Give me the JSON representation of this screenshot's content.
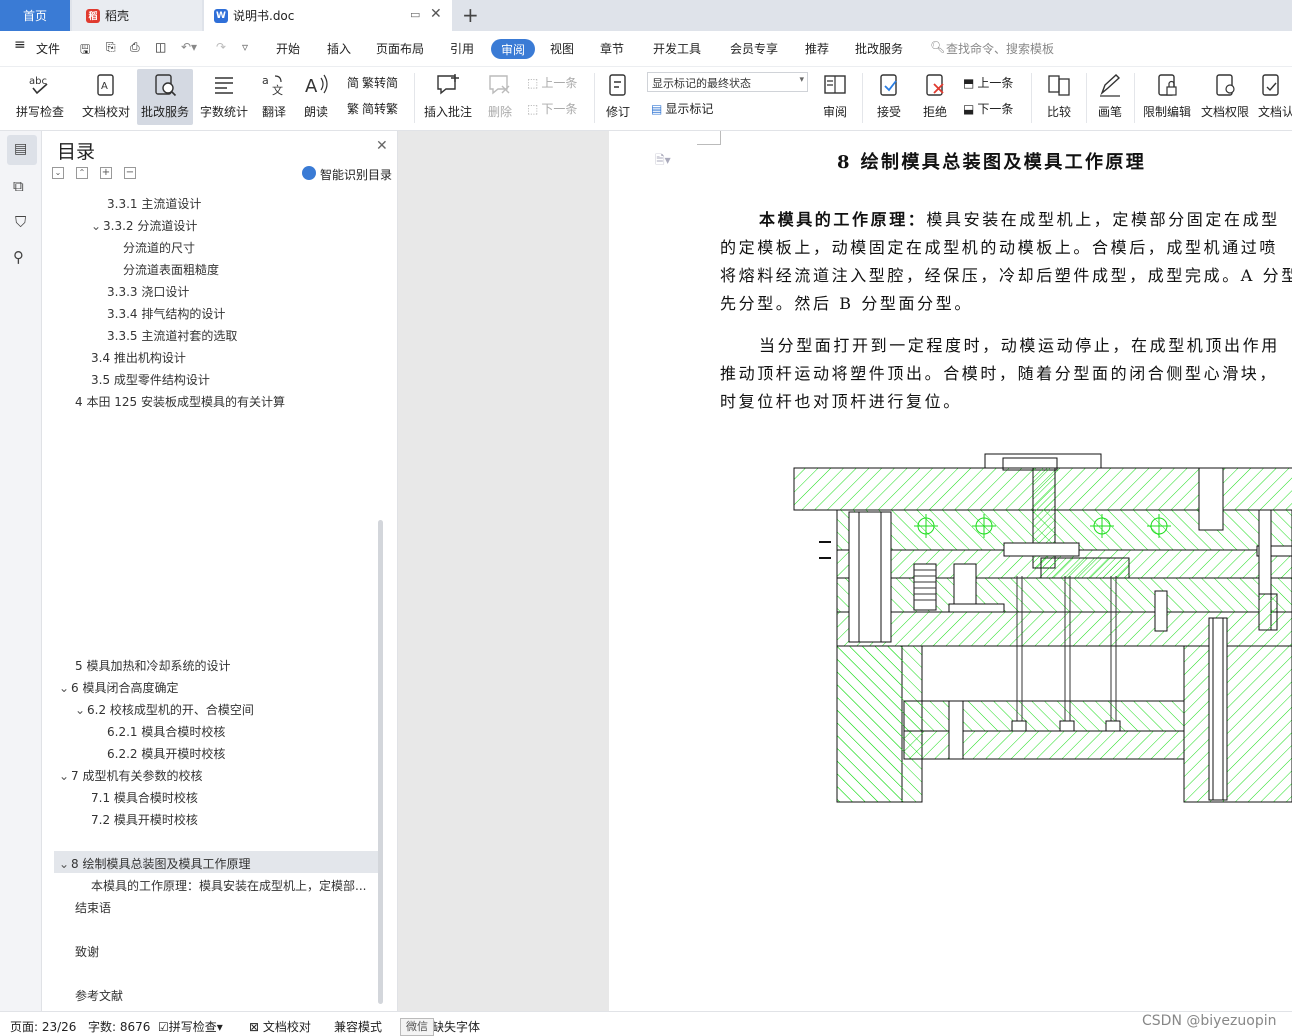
{
  "tabs": {
    "home": "首页",
    "daoke": "稻壳",
    "doc": "说明书.doc"
  },
  "menu": {
    "file": "文件",
    "items": [
      "开始",
      "插入",
      "页面布局",
      "引用",
      "审阅",
      "视图",
      "章节",
      "开发工具",
      "会员专享",
      "推荐",
      "批改服务"
    ],
    "search_placeholder": "查找命令、搜索模板"
  },
  "ribbon": {
    "spell": "拼写检查",
    "proof": "文档校对",
    "correct": "批改服务",
    "wordcount": "字数统计",
    "translate": "翻译",
    "read": "朗读",
    "trad": "繁转简",
    "simp": "简转繁",
    "insert_comment": "插入批注",
    "delete": "删除",
    "prev": "上一条",
    "next": "下一条",
    "revise": "修订",
    "markup_state": "显示标记的最终状态",
    "show_markup": "显示标记",
    "review": "审阅",
    "accept": "接受",
    "reject": "拒绝",
    "prev2": "上一条",
    "next2": "下一条",
    "compare": "比较",
    "pen": "画笔",
    "restrict": "限制编辑",
    "perm": "文档权限",
    "docauth": "文档认"
  },
  "toc": {
    "title": "目录",
    "smart": "智能识别目录",
    "items": [
      {
        "text": "3.3.1   主流道设计"
      },
      {
        "text": "3.3.2 分流道设计"
      },
      {
        "text": "分流道的尺寸"
      },
      {
        "text": "分流道表面粗糙度"
      },
      {
        "text": "3.3.3 浇口设计"
      },
      {
        "text": "3.3.4 排气结构的设计"
      },
      {
        "text": "3.3.5 主流道衬套的选取"
      },
      {
        "text": "3.4 推出机构设计"
      },
      {
        "text": "3.5 成型零件结构设计"
      },
      {
        "text": "4  本田 125 安装板成型模具的有关计算"
      },
      {
        "text": "5  模具加热和冷却系统的设计"
      },
      {
        "text": "6  模具闭合高度确定"
      },
      {
        "text": "6.2  校核成型机的开、合模空间"
      },
      {
        "text": "6.2.1 模具合模时校核"
      },
      {
        "text": "6.2.2 模具开模时校核"
      },
      {
        "text": "7  成型机有关参数的校核"
      },
      {
        "text": "7.1 模具合模时校核"
      },
      {
        "text": "7.2 模具开模时校核"
      },
      {
        "text": "8  绘制模具总装图及模具工作原理"
      },
      {
        "text": "本模具的工作原理：模具安装在成型机上，定模部..."
      },
      {
        "text": "结束语"
      },
      {
        "text": "致谢"
      },
      {
        "text": "参考文献"
      }
    ]
  },
  "doc": {
    "heading": "8  绘制模具总装图及模具工作原理",
    "p1_bold": "本模具的工作原理：",
    "p1_l1": "模具安装在成型机上，定模部分固定在成型",
    "p1_l2": "的定模板上，动模固定在成型机的动模板上。合模后，成型机通过喷",
    "p1_l3": "将熔料经流道注入型腔，经保压，冷却后塑件成型，成型完成。A 分型",
    "p1_l4": "先分型。然后 B 分型面分型。",
    "p2_l1": "当分型面打开到一定程度时，动模运动停止，在成型机顶出作用",
    "p2_l2": "推动顶杆运动将塑件顶出。合模时，随着分型面的闭合侧型心滑块，",
    "p2_l3": "时复位杆也对顶杆进行复位。"
  },
  "status": {
    "page": "页面: 23/26",
    "words": "字数: 8676",
    "spell": "拼写检查",
    "proof": "文档校对",
    "compat": "兼容模式",
    "font": "缺失字体",
    "wechat": "微信"
  },
  "watermark": "CSDN @biyezuopin",
  "colors": {
    "accent": "#3a7bd5",
    "hatch": "#00dd00"
  }
}
